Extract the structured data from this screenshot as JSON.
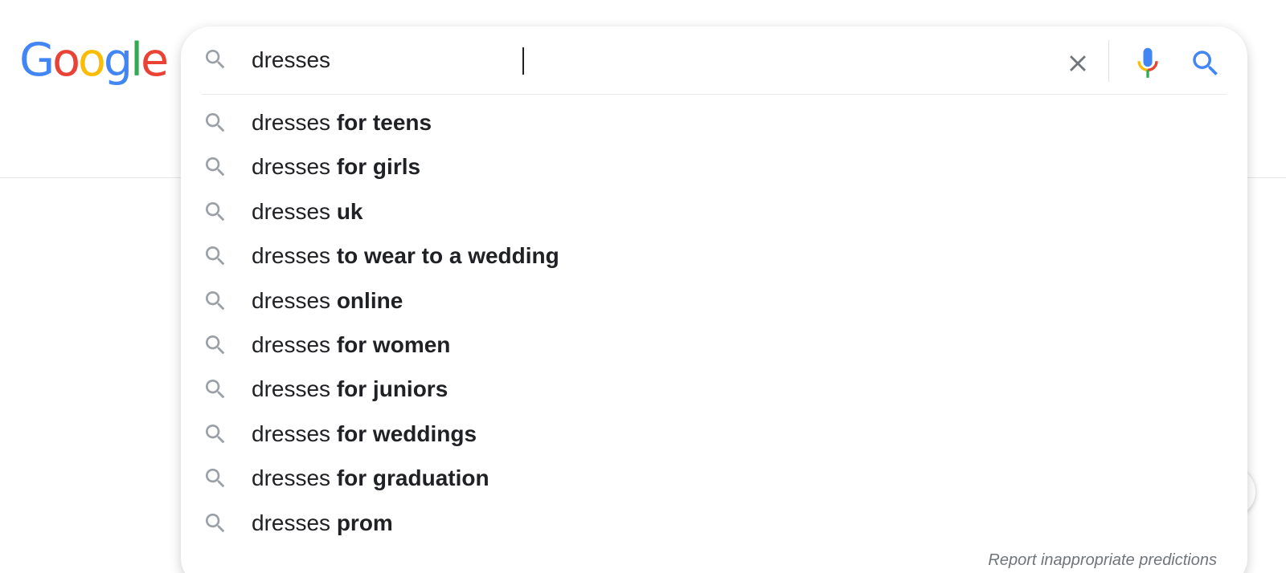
{
  "logo": {
    "letters": [
      {
        "char": "G",
        "color": "#4285F4"
      },
      {
        "char": "o",
        "color": "#EA4335"
      },
      {
        "char": "o",
        "color": "#FBBC05"
      },
      {
        "char": "g",
        "color": "#4285F4"
      },
      {
        "char": "l",
        "color": "#34A853"
      },
      {
        "char": "e",
        "color": "#EA4335"
      }
    ]
  },
  "search": {
    "query": "dresses ",
    "lead_icon": "search-icon",
    "clear_icon": "close-icon",
    "mic_icon": "microphone-icon",
    "submit_icon": "search-icon"
  },
  "suggestions": [
    {
      "prefix": "dresses ",
      "completion": "for teens"
    },
    {
      "prefix": "dresses ",
      "completion": "for girls"
    },
    {
      "prefix": "dresses ",
      "completion": "uk"
    },
    {
      "prefix": "dresses ",
      "completion": "to wear to a wedding"
    },
    {
      "prefix": "dresses ",
      "completion": "online"
    },
    {
      "prefix": "dresses ",
      "completion": "for women"
    },
    {
      "prefix": "dresses ",
      "completion": "for juniors"
    },
    {
      "prefix": "dresses ",
      "completion": "for weddings"
    },
    {
      "prefix": "dresses ",
      "completion": "for graduation"
    },
    {
      "prefix": "dresses ",
      "completion": "prom"
    }
  ],
  "report_link": "Report inappropriate predictions",
  "colors": {
    "blue": "#4285F4",
    "red": "#EA4335",
    "yellow": "#FBBC05",
    "green": "#34A853",
    "icon_gray": "#9aa0a6"
  }
}
